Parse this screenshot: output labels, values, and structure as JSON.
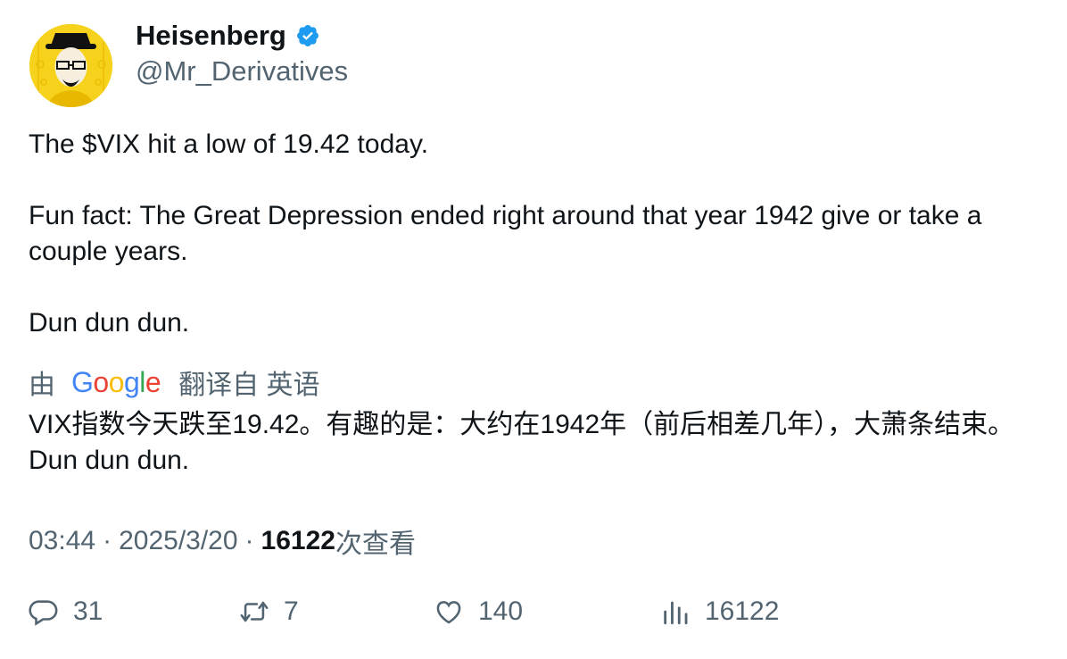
{
  "author": {
    "display_name": "Heisenberg",
    "handle": "@Mr_Derivatives",
    "verified": true,
    "avatar_icon": "heisenberg-avatar",
    "verified_color": "#1d9bf0"
  },
  "tweet": {
    "lines": [
      "The $VIX hit a low of 19.42 today.",
      "",
      "Fun fact: The Great Depression ended right around that year 1942 give or take a couple years.",
      "",
      "Dun dun dun."
    ]
  },
  "translation": {
    "prefix": "由",
    "provider": "Google",
    "suffix": "翻译自 英语",
    "text": "VIX指数今天跌至19.42。有趣的是：大约在1942年（前后相差几年），大萧条结束。 Dun dun dun."
  },
  "meta": {
    "time": "03:44",
    "separator": "·",
    "date": "2025/3/20",
    "views_count": "16122",
    "views_label": "次查看"
  },
  "actions": {
    "replies": "31",
    "retweets": "7",
    "likes": "140",
    "views": "16122"
  },
  "colors": {
    "text": "#0f1419",
    "secondary": "#536471",
    "avatar_bg": "#f7d21c"
  }
}
